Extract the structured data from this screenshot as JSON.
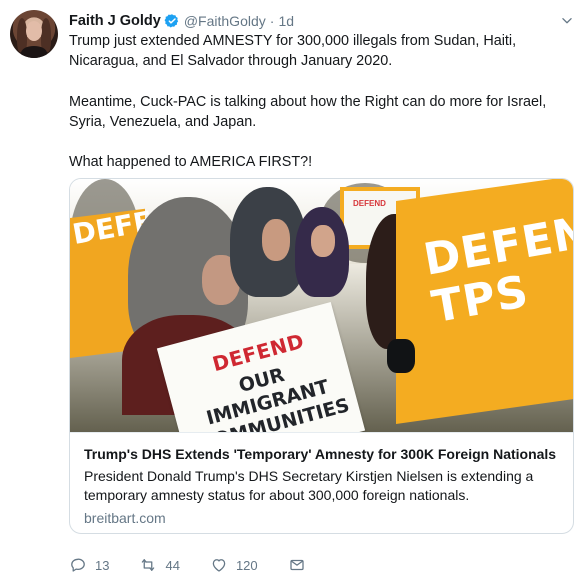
{
  "author": {
    "name": "Faith J Goldy",
    "handle": "@FaithGoldy",
    "separator": "·",
    "time": "1d",
    "verified_icon": "verified-check-icon"
  },
  "tweet": {
    "paragraphs": [
      "Trump just extended AMNESTY for 300,000 illegals from Sudan, Haiti, Nicaragua, and El Salvador through January 2020.",
      "Meantime, Cuck-PAC is talking about how the Right can do more for Israel, Syria, Venezuela, and Japan.",
      "What happened to AMERICA FIRST?!"
    ]
  },
  "card": {
    "image_signs": {
      "front_top": "DEFEND",
      "front_bottom": "OUR IMMIGRANT COMMUNITIES",
      "right": "DEFEND TPS",
      "left": "DEFE TP"
    },
    "title": "Trump's DHS Extends 'Temporary' Amnesty for 300K Foreign Nationals",
    "description": "President Donald Trump's DHS Secretary Kirstjen Nielsen is extending a temporary amnesty status for about 300,000 foreign nationals.",
    "domain": "breitbart.com"
  },
  "actions": {
    "reply_count": "13",
    "retweet_count": "44",
    "like_count": "120",
    "icons": {
      "reply": "reply-icon",
      "retweet": "retweet-icon",
      "like": "heart-icon",
      "message": "mail-icon",
      "more": "chevron-down-icon"
    },
    "colors": {
      "muted": "#657786",
      "verified": "#1da1f2"
    }
  }
}
